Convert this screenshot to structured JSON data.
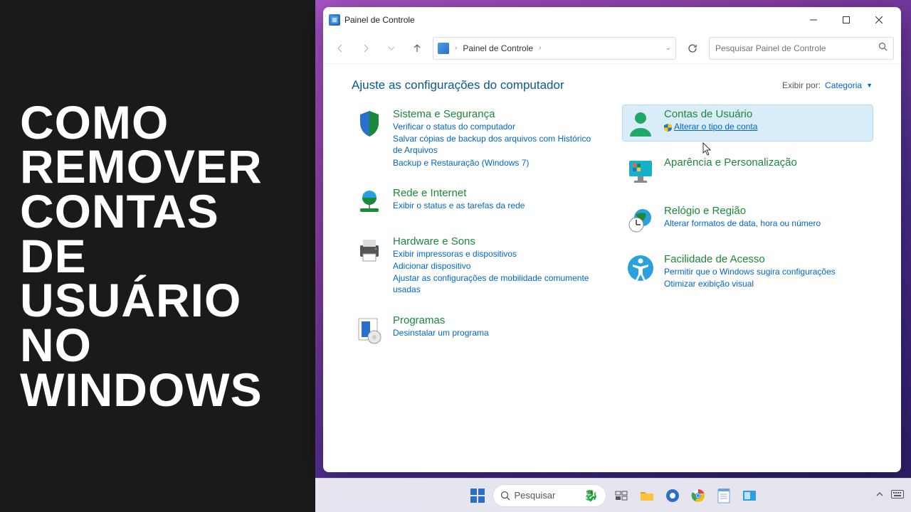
{
  "thumbnail_title": "COMO REMOVER CONTAS DE USUÁRIO NO WINDOWS",
  "window": {
    "title": "Painel de Controle",
    "address_text": "Painel de Controle",
    "search_placeholder": "Pesquisar Painel de Controle"
  },
  "content": {
    "heading": "Ajuste as configurações do computador",
    "viewby_label": "Exibir por:",
    "viewby_value": "Categoria"
  },
  "categories": {
    "system": {
      "title": "Sistema e Segurança",
      "links": [
        "Verificar o status do computador",
        "Salvar cópias de backup dos arquivos com Histórico de Arquivos",
        "Backup e Restauração (Windows 7)"
      ]
    },
    "network": {
      "title": "Rede e Internet",
      "links": [
        "Exibir o status e as tarefas da rede"
      ]
    },
    "hardware": {
      "title": "Hardware e Sons",
      "links": [
        "Exibir impressoras e dispositivos",
        "Adicionar dispositivo",
        "Ajustar as configurações de mobilidade comumente usadas"
      ]
    },
    "programs": {
      "title": "Programas",
      "links": [
        "Desinstalar um programa"
      ]
    },
    "accounts": {
      "title": "Contas de Usuário",
      "links": [
        "Alterar o tipo de conta"
      ]
    },
    "appearance": {
      "title": "Aparência e Personalização",
      "links": []
    },
    "clock": {
      "title": "Relógio e Região",
      "links": [
        "Alterar formatos de data, hora ou número"
      ]
    },
    "ease": {
      "title": "Facilidade de Acesso",
      "links": [
        "Permitir que o Windows sugira configurações",
        "Otimizar exibição visual"
      ]
    }
  },
  "taskbar": {
    "search_placeholder": "Pesquisar"
  }
}
